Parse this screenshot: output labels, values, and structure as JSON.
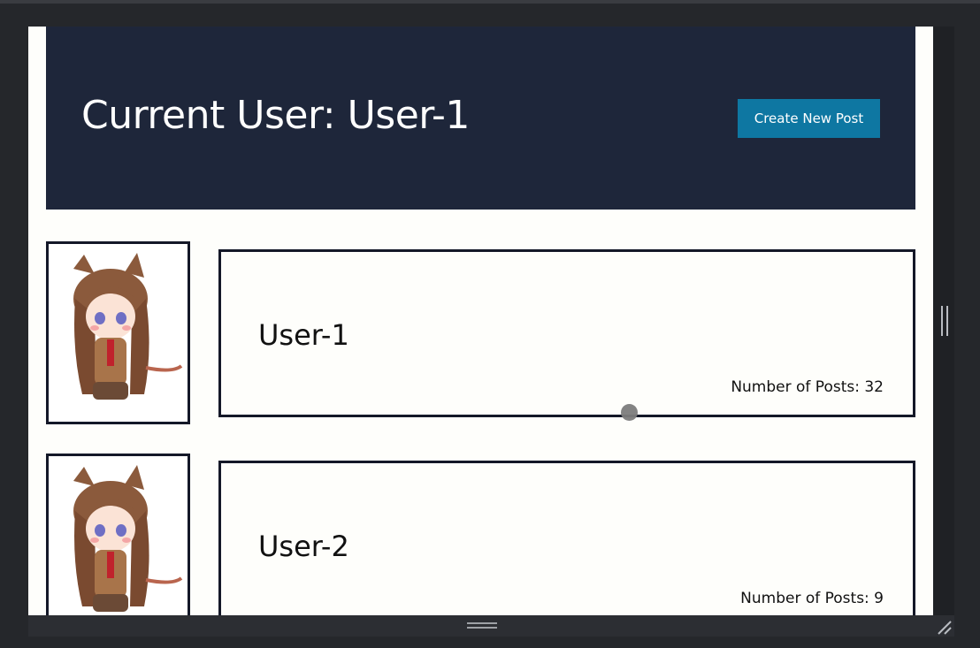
{
  "header": {
    "title": "Current User: User-1",
    "create_button_label": "Create New Post"
  },
  "users": [
    {
      "name": "User-1",
      "posts_label": "Number of Posts: 32",
      "avatar_icon": "anime-girl-avatar"
    },
    {
      "name": "User-2",
      "posts_label": "Number of Posts: 9",
      "avatar_icon": "anime-girl-avatar"
    }
  ],
  "colors": {
    "header_bg": "#1e263a",
    "button_bg": "#0e77a2",
    "page_bg": "#fefefb",
    "border": "#141828"
  }
}
